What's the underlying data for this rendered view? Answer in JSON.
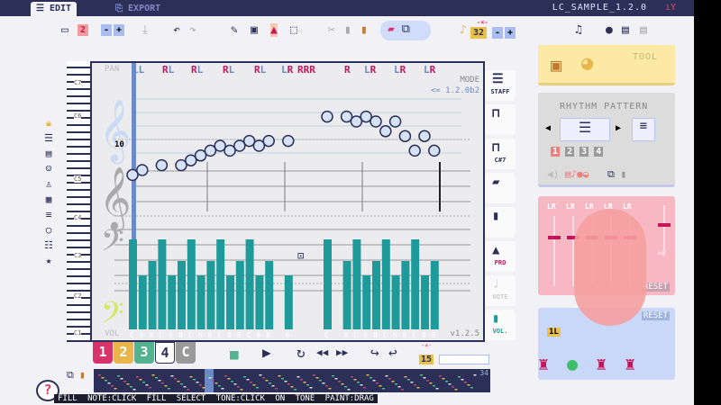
{
  "titlebar": {
    "tabs": [
      {
        "label": "EDIT",
        "active": true
      },
      {
        "label": "EXPORT",
        "active": false
      }
    ],
    "file": "LC_SAMPLE_1.2.0",
    "signal_icon": "signal-icon"
  },
  "toolbar": {
    "page_number": "2",
    "minus": "-",
    "plus": "+",
    "speed_label": "-×-",
    "speed": "32"
  },
  "editor": {
    "pan_label": "PAN",
    "mode_label": "MODE",
    "mode_value": "<= 1.2.0b2",
    "marker": "10",
    "vol_label": "VOL",
    "version": "v1.2.5",
    "octave_labels": [
      "C7",
      "C6",
      "C5",
      "C4",
      "C3",
      "C2",
      "C1"
    ],
    "pan_marks": [
      "LL",
      "RL",
      "RL",
      "RL",
      "RL",
      "LR",
      "RRR",
      "R",
      "LR",
      "LR",
      "LR"
    ],
    "notes": [
      [
        0,
        14
      ],
      [
        1,
        15
      ],
      [
        3,
        16
      ],
      [
        5,
        16
      ],
      [
        6,
        17
      ],
      [
        7,
        18
      ],
      [
        8,
        19
      ],
      [
        9,
        20
      ],
      [
        10,
        19
      ],
      [
        11,
        20
      ],
      [
        12,
        21
      ],
      [
        13,
        20
      ],
      [
        14,
        21
      ],
      [
        16,
        21
      ],
      [
        20,
        26
      ],
      [
        22,
        26
      ],
      [
        23,
        25
      ],
      [
        24,
        26
      ],
      [
        25,
        25
      ],
      [
        26,
        23
      ],
      [
        27,
        25
      ],
      [
        28,
        22
      ],
      [
        29,
        19
      ],
      [
        30,
        22
      ],
      [
        31,
        19
      ]
    ],
    "volume_bars": [
      {
        "slot": 0,
        "label": "C",
        "level": 100
      },
      {
        "slot": 1,
        "label": "6",
        "level": 60
      },
      {
        "slot": 2,
        "label": "8",
        "level": 76
      },
      {
        "slot": 3,
        "label": "C",
        "level": 100
      },
      {
        "slot": 4,
        "label": "6",
        "level": 60
      },
      {
        "slot": 5,
        "label": "8",
        "level": 76
      },
      {
        "slot": 6,
        "label": "C",
        "level": 100
      },
      {
        "slot": 7,
        "label": "6",
        "level": 60
      },
      {
        "slot": 8,
        "label": "8",
        "level": 76
      },
      {
        "slot": 9,
        "label": "C",
        "level": 100
      },
      {
        "slot": 10,
        "label": "6",
        "level": 60
      },
      {
        "slot": 11,
        "label": "8",
        "level": 76
      },
      {
        "slot": 12,
        "label": "C",
        "level": 100
      },
      {
        "slot": 13,
        "label": "6",
        "level": 60
      },
      {
        "slot": 14,
        "label": "8",
        "level": 76
      },
      {
        "slot": 16,
        "label": "6",
        "level": 60
      },
      {
        "slot": 20,
        "label": "C",
        "level": 100
      },
      {
        "slot": 22,
        "label": "8",
        "level": 76
      },
      {
        "slot": 23,
        "label": "C",
        "level": 100
      },
      {
        "slot": 24,
        "label": "6",
        "level": 60
      },
      {
        "slot": 25,
        "label": "8",
        "level": 76
      },
      {
        "slot": 26,
        "label": "C",
        "level": 100
      },
      {
        "slot": 27,
        "label": "6",
        "level": 60
      },
      {
        "slot": 28,
        "label": "8",
        "level": 76
      },
      {
        "slot": 29,
        "label": "C",
        "level": 100
      },
      {
        "slot": 30,
        "label": "6",
        "level": 60
      },
      {
        "slot": 31,
        "label": "8",
        "level": 76
      }
    ]
  },
  "right_tools": [
    {
      "label": "STAFF"
    },
    {
      "label": ""
    },
    {
      "label": "C#7"
    },
    {
      "label": ""
    },
    {
      "label": ""
    },
    {
      "label": "PRO"
    },
    {
      "label": "NOTE"
    },
    {
      "label": "VOL."
    }
  ],
  "panels": {
    "tool_label": "TOOL",
    "rhythm_title": "RHYTHM PATTERN",
    "rhythm_slots": [
      "1",
      "2",
      "3",
      "4"
    ],
    "mixer_channels": [
      "LR",
      "LR",
      "LR",
      "LR",
      "LR"
    ],
    "mixer_zero": "+0",
    "reset": "RESET",
    "reset2": "RESET",
    "track_label": "1L"
  },
  "channels": [
    {
      "label": "1",
      "color": "#d8336a"
    },
    {
      "label": "2",
      "color": "#e8b64a"
    },
    {
      "label": "3",
      "color": "#52b38e"
    },
    {
      "label": "4",
      "color": "#ffffff"
    },
    {
      "label": "C",
      "color": "#9a9a9a"
    }
  ],
  "transport": {
    "stop": "■",
    "play": "▶",
    "loop": "↻",
    "rewind": "◀◀",
    "forward": "▶▶",
    "undo": "↩",
    "redo": "↪",
    "tempo_label": "-×-",
    "tempo": "15"
  },
  "overview": {
    "page_count": "34"
  },
  "status": "FILL NOTE:CLICK   FILL SELECT TONE:CLICK ON TONE   PAINT:DRAG",
  "colors": {
    "accent": "#2c2f57",
    "volume": "#1e9a9a",
    "pan_r": "#c2185b",
    "pan_l": "#6c8ac8"
  }
}
